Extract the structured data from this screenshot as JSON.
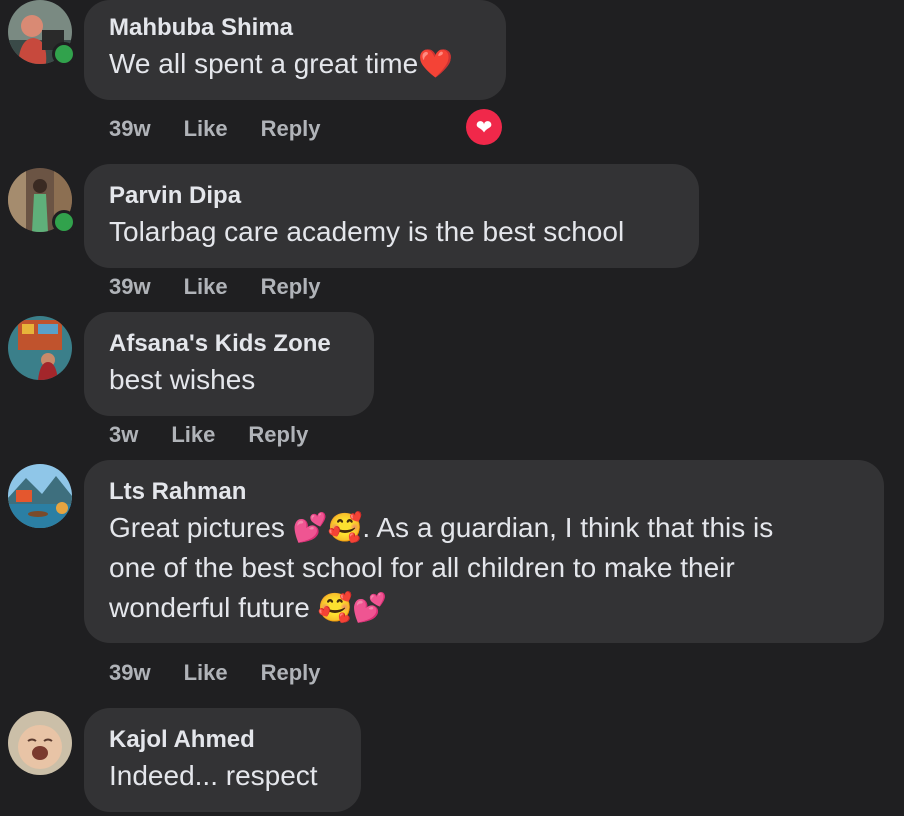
{
  "comments": [
    {
      "author": "Mahbuba Shima",
      "text": "We all spent a great time",
      "emoji": "❤️",
      "time": "39w",
      "like": "Like",
      "reply": "Reply",
      "reaction_icon": "heart-icon"
    },
    {
      "author": "Parvin Dipa",
      "text": "Tolarbag care academy is the best school",
      "time": "39w",
      "like": "Like",
      "reply": "Reply"
    },
    {
      "author": "Afsana's Kids Zone",
      "text": "best wishes",
      "time": "3w",
      "like": "Like",
      "reply": "Reply"
    },
    {
      "author": "Lts Rahman",
      "text_line1": "Great pictures 💕🥰. As a guardian, I think that this is",
      "text_line2": "one of the best school for all children to make their",
      "text_line3": "wonderful future 🥰💕",
      "time": "39w",
      "like": "Like",
      "reply": "Reply"
    },
    {
      "author": "Kajol Ahmed",
      "text": "Indeed... respect"
    }
  ],
  "colors": {
    "background": "#1f1f21",
    "bubble": "#333335",
    "meta_text": "#b0b3b8",
    "online": "#31a24c",
    "heart": "#f0284a"
  }
}
